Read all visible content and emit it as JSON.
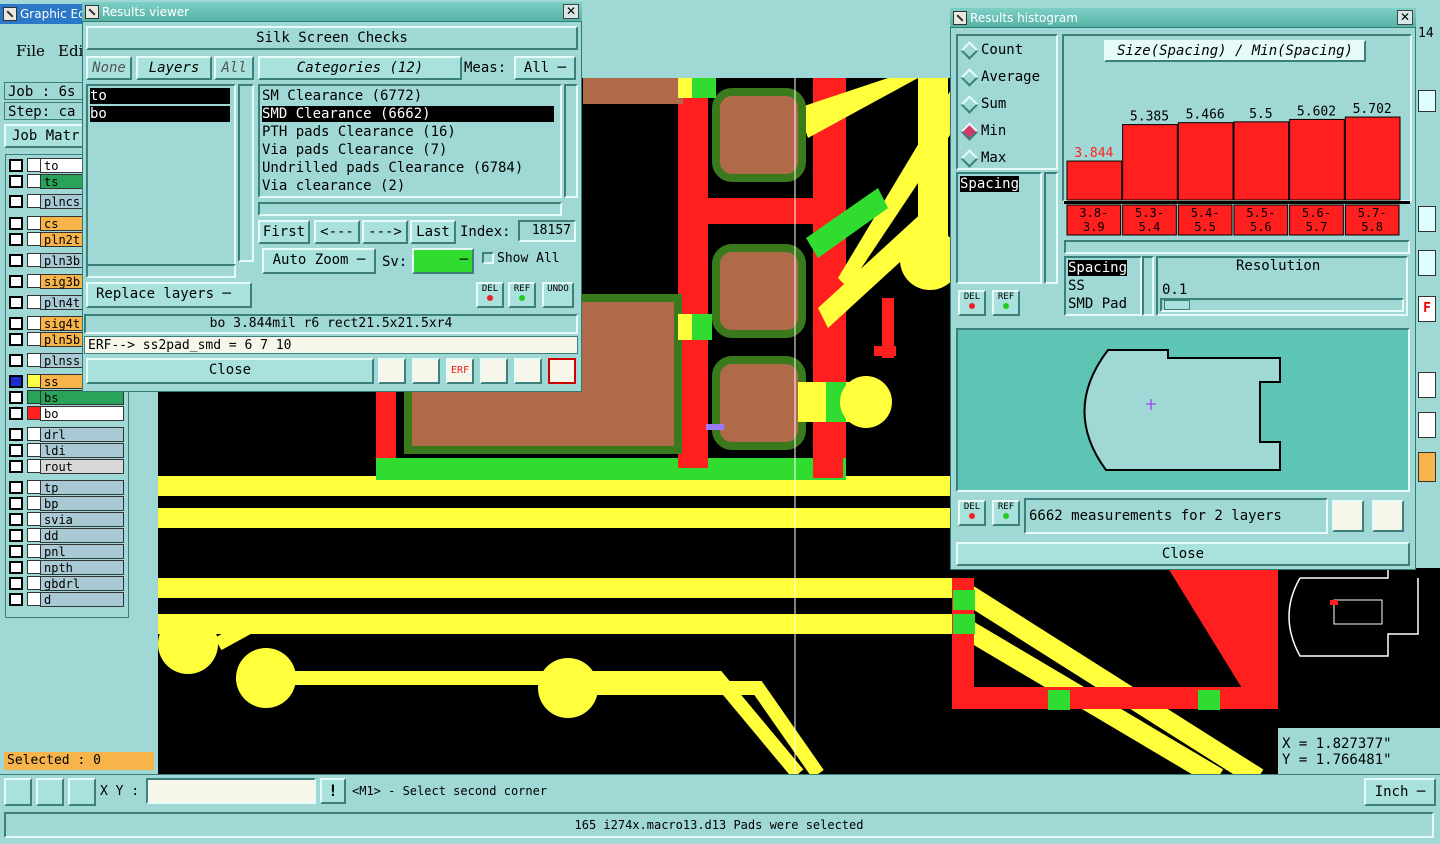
{
  "main": {
    "title": "Graphic Ed",
    "menu": {
      "file": "File",
      "edit": "Edi"
    },
    "job": "Job : 6s",
    "step": "Step: ca",
    "job_matrix": "Job Matr",
    "selected": "Selected : 0",
    "xy_label": "X Y :",
    "status_msg": "<M1> - Select second corner",
    "unit": "Inch",
    "bottom_status": "165 i274x.macro13.d13 Pads were selected",
    "coord_x": "X = 1.827377\"",
    "coord_y": "Y = 1.766481\"",
    "right_toolbar_num": "14"
  },
  "layers": [
    {
      "name": "to",
      "color": "#ffffff",
      "swatch": "#ffffff"
    },
    {
      "name": "ts",
      "color": "#2aa35a",
      "swatch": "#ffffff"
    },
    {
      "name": "plncs",
      "color": "#a9c9d4",
      "swatch": "#ffffff"
    },
    {
      "name": "cs",
      "color": "#f7b44a",
      "swatch": "#ffffff"
    },
    {
      "name": "pln2t",
      "color": "#f7b44a",
      "swatch": "#ffffff"
    },
    {
      "name": "pln3b",
      "color": "#a9c9d4",
      "swatch": "#ffffff"
    },
    {
      "name": "sig3b",
      "color": "#f7b44a",
      "swatch": "#ffffff"
    },
    {
      "name": "pln4t",
      "color": "#a9c9d4",
      "swatch": "#ffffff"
    },
    {
      "name": "sig4t",
      "color": "#f7b44a",
      "swatch": "#ffffff"
    },
    {
      "name": "pln5b",
      "color": "#f7b44a",
      "swatch": "#ffffff"
    },
    {
      "name": "plnss",
      "color": "#a9c9d4",
      "swatch": "#ffffff"
    },
    {
      "name": "ss",
      "color": "#f7b44a",
      "swatch": "#ffff44"
    },
    {
      "name": "bs",
      "color": "#2aa35a",
      "swatch": "#2aa35a"
    },
    {
      "name": "bo",
      "color": "#ffffff",
      "swatch": "#ff1f1f"
    },
    {
      "name": "drl",
      "color": "#a9c9d4",
      "swatch": "#ffffff"
    },
    {
      "name": "ldi",
      "color": "#a9c9d4",
      "swatch": "#ffffff"
    },
    {
      "name": "rout",
      "color": "#d8d8d8",
      "swatch": "#ffffff"
    },
    {
      "name": "tp",
      "color": "#a9c9d4",
      "swatch": "#ffffff"
    },
    {
      "name": "bp",
      "color": "#a9c9d4",
      "swatch": "#ffffff"
    },
    {
      "name": "svia",
      "color": "#a9c9d4",
      "swatch": "#ffffff"
    },
    {
      "name": "dd",
      "color": "#a9c9d4",
      "swatch": "#ffffff"
    },
    {
      "name": "pnl",
      "color": "#a9c9d4",
      "swatch": "#ffffff"
    },
    {
      "name": "npth",
      "color": "#a9c9d4",
      "swatch": "#ffffff"
    },
    {
      "name": "gbdrl",
      "color": "#a9c9d4",
      "swatch": "#ffffff"
    },
    {
      "name": "d",
      "color": "#a9c9d4",
      "swatch": "#ffffff"
    }
  ],
  "viewer": {
    "title": "Results viewer",
    "heading": "Silk Screen Checks",
    "none": "None",
    "layers": "Layers",
    "all": "All",
    "layer_list": [
      "to",
      "bo"
    ],
    "categories_label": "Categories (12)",
    "meas_label": "Meas:",
    "meas_value": "All",
    "categories": [
      "SM Clearance (6772)",
      "SMD Clearance (6662)",
      "PTH pads Clearance (16)",
      "Via pads Clearance (7)",
      "Undrilled pads Clearance (6784)",
      "Via clearance (2)"
    ],
    "first": "First",
    "prev": "<---",
    "next": "--->",
    "last": "Last",
    "index_label": "Index:",
    "index_value": "18157",
    "auto_zoom": "Auto Zoom",
    "sv": "Sv:",
    "show_all": "Show All",
    "replace_layers": "Replace layers",
    "del": "DEL",
    "ref": "REF",
    "undo": "UNDO",
    "info": "bo 3.844mil  r6  rect21.5x21.5xr4",
    "erf": "ERF--> ss2pad_smd = 6 7 10",
    "close": "Close"
  },
  "histogram": {
    "title": "Results histogram",
    "options": [
      "Count",
      "Average",
      "Sum",
      "Min",
      "Max"
    ],
    "selected_option": "Min",
    "chart_title": "Size(Spacing) / Min(Spacing)",
    "list": [
      "Spacing"
    ],
    "list2": [
      "Spacing",
      "SS",
      "SMD Pad"
    ],
    "resolution_label": "Resolution",
    "resolution_value": "0.1",
    "measurements": "6662 measurements for 2 layers",
    "close": "Close",
    "del": "DEL",
    "ref": "REF"
  },
  "chart_data": {
    "type": "bar",
    "title": "Size(Spacing) / Min(Spacing)",
    "categories": [
      "3.8-3.9",
      "5.3-5.4",
      "5.4-5.5",
      "5.5-5.6",
      "5.6-5.7",
      "5.7-5.8"
    ],
    "category_labels": [
      [
        "3.8-",
        "3.9"
      ],
      [
        "5.3-",
        "5.4"
      ],
      [
        "5.4-",
        "5.5"
      ],
      [
        "5.5-",
        "5.6"
      ],
      [
        "5.6-",
        "5.7"
      ],
      [
        "5.7-",
        "5.8"
      ]
    ],
    "values": [
      3.844,
      5.385,
      5.466,
      5.5,
      5.602,
      5.702
    ],
    "value_labels": [
      "3.844",
      "5.385",
      "5.466",
      "5.5",
      "5.602",
      "5.702"
    ],
    "highlight_index": 0,
    "ylim": [
      2.2,
      6.0
    ]
  }
}
